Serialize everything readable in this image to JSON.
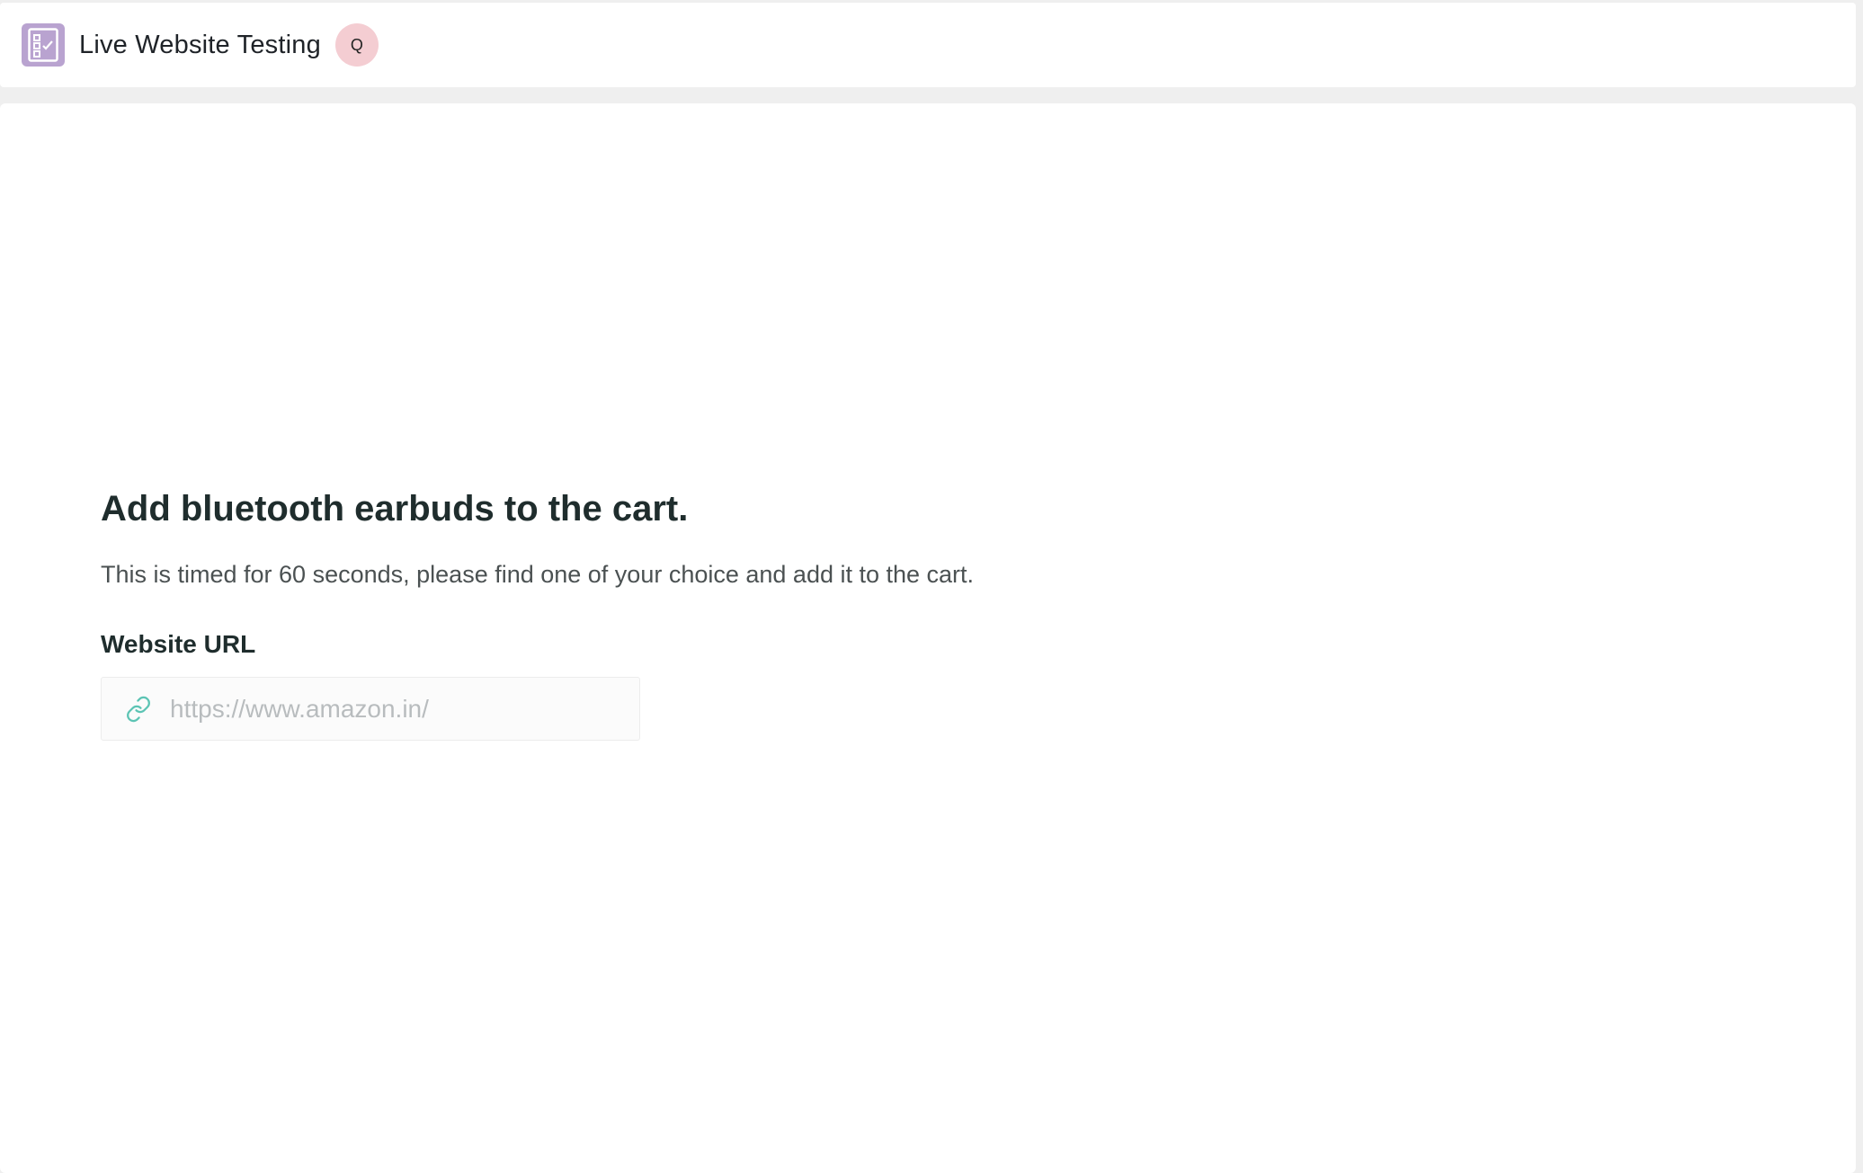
{
  "header": {
    "app_icon": "checklist-icon",
    "title": "Live Website Testing",
    "avatar_initial": "Q"
  },
  "task": {
    "title": "Add bluetooth earbuds to the cart.",
    "description": "This is timed for 60 seconds, please find one of your choice and add it to the cart.",
    "url_label": "Website URL",
    "url_placeholder": "https://www.amazon.in/",
    "url_value": "",
    "url_icon": "link-icon"
  },
  "colors": {
    "app_icon_bg": "#b9a3d0",
    "avatar_bg": "#f4cdd2",
    "link_icon": "#5cc4b4"
  }
}
